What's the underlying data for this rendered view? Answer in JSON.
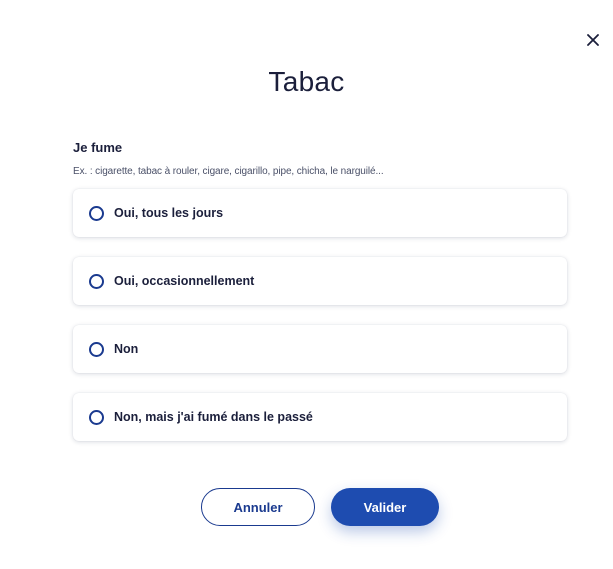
{
  "modal": {
    "title": "Tabac",
    "question": "Je fume",
    "hint": "Ex. : cigarette, tabac à rouler, cigare, cigarillo, pipe, chicha, le narguilé...",
    "options": [
      {
        "label": "Oui, tous les jours",
        "selected": false
      },
      {
        "label": "Oui, occasionnellement",
        "selected": false
      },
      {
        "label": "Non",
        "selected": false
      },
      {
        "label": "Non, mais j'ai fumé dans le passé",
        "selected": false
      }
    ],
    "buttons": {
      "cancel": "Annuler",
      "validate": "Valider"
    },
    "close_icon": "close-icon"
  },
  "colors": {
    "primary": "#1e4cb0",
    "radio_border": "#1a3a8f",
    "text": "#1b1f3b"
  }
}
